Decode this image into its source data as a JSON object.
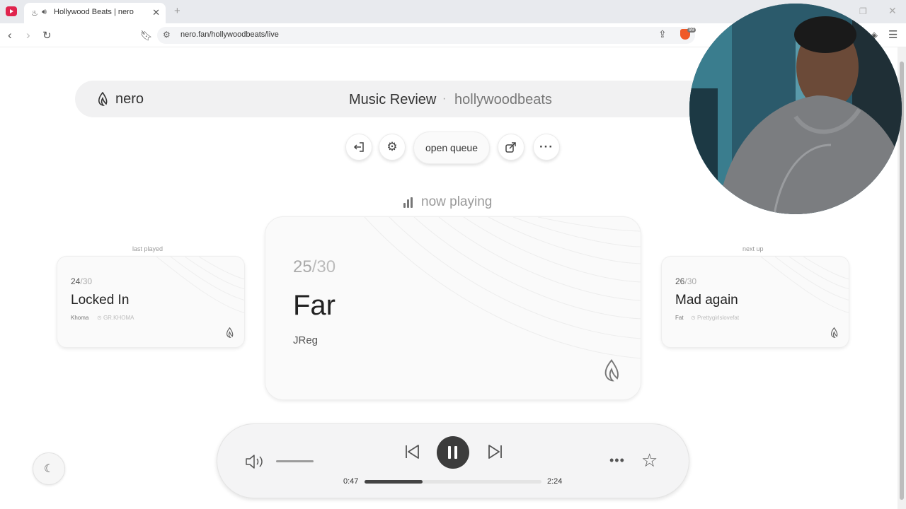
{
  "browser": {
    "tab_title": "Hollywood Beats | nero",
    "tab_close": "✕",
    "new_tab": "+",
    "url": "nero.fan/hollywoodbeats/live"
  },
  "header": {
    "logo_text": "nero",
    "title": "Music Review",
    "separator": "·",
    "channel": "hollywoodbeats"
  },
  "toolbar": {
    "open_queue_label": "open queue"
  },
  "now_playing": {
    "label": "now playing"
  },
  "last_played": {
    "section_label": "last played",
    "number": "24",
    "total": "/30",
    "title": "Locked In",
    "artist": "Khoma",
    "handle": "GR.KHOMA"
  },
  "current": {
    "number": "25",
    "total": "/30",
    "title": "Far",
    "artist": "JReg"
  },
  "next_up": {
    "section_label": "next up",
    "number": "26",
    "total": "/30",
    "title": "Mad again",
    "artist": "Fat",
    "handle": "Prettygirlslovefat"
  },
  "player": {
    "current_time": "0:47",
    "total_time": "2:24",
    "progress": 0.326,
    "volume": 0.55
  },
  "colors": {
    "accent": "#3c3c3c",
    "youtube_red": "#e0244d",
    "brave_orange": "#f05a28"
  }
}
